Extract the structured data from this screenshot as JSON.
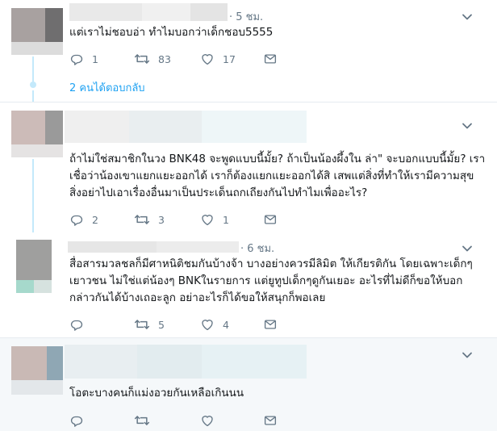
{
  "tweets": [
    {
      "timestamp": "· 5 ชม.",
      "text_lines": [
        "แต่เราไม่ชอบอ่า ทำไมบอกว่าเด็กชอบ5555"
      ],
      "actions": {
        "reply": "1",
        "retweet": "83",
        "like": "17"
      },
      "more_replies": "2 คนได้ตอบกลับ"
    },
    {
      "timestamp": "",
      "text_lines": [
        "ถ้าไม่ใช่สมาชิกในวง BNK48 จะพูดแบบนี้มั้ย? ถ้าเป็นน้องผึ้งใน ล่า\" จะบอกแบบนี้มั้ย? เรา",
        "เชื่อว่าน้องเขาแยกแยะออกได้ เราก็ต้องแยกแยะออกได้สิ เสพแต่สิ่งที่ทำให้เรามีความสุข",
        "สิ่งอย่าไปเอาเรื่องอื่นมาเป็นประเด็นถกเถียงกันไปทำไมเพื่ออะไร?"
      ],
      "actions": {
        "reply": "2",
        "retweet": "3",
        "like": "1"
      }
    },
    {
      "timestamp": "· 6 ชม.",
      "text_lines": [
        "สื่อสารมวลชลก็มีศาหนิติชมกันบ้างจ้า บางอย่างควรมีลิมิต ให้เกียรติกัน โดยเฉพาะเด็กๆ",
        "เยาวชน ไม่ใช่แต่น้องๆ BNKในรายการ แต่ยูทูปเด็กๆดูกันเยอะ อะไรที่ไม่ดีก็ขอให้บอก",
        "กล่าวกันได้บ้างเถอะลูก อย่าอะไรก็ได้ขอให้สนุกก็พอเลย"
      ],
      "actions": {
        "reply": "",
        "retweet": "5",
        "like": "4"
      }
    },
    {
      "timestamp": "",
      "text_lines": [
        "โอตะบางคนก็แม่งอวยกันเหลือเกินนน"
      ],
      "actions": {
        "reply": "",
        "retweet": "",
        "like": ""
      }
    }
  ],
  "icons": {
    "reply": "reply-icon",
    "retweet": "retweet-icon",
    "like": "heart-icon",
    "dm": "envelope-icon",
    "menu": "chevron-down-icon"
  },
  "colors": {
    "text": "#14171a",
    "muted": "#657786",
    "link": "#1da1f2",
    "thread": "#c4e9fb",
    "divider": "#e6ecf0",
    "highlight_bg": "#f5f8fa"
  }
}
